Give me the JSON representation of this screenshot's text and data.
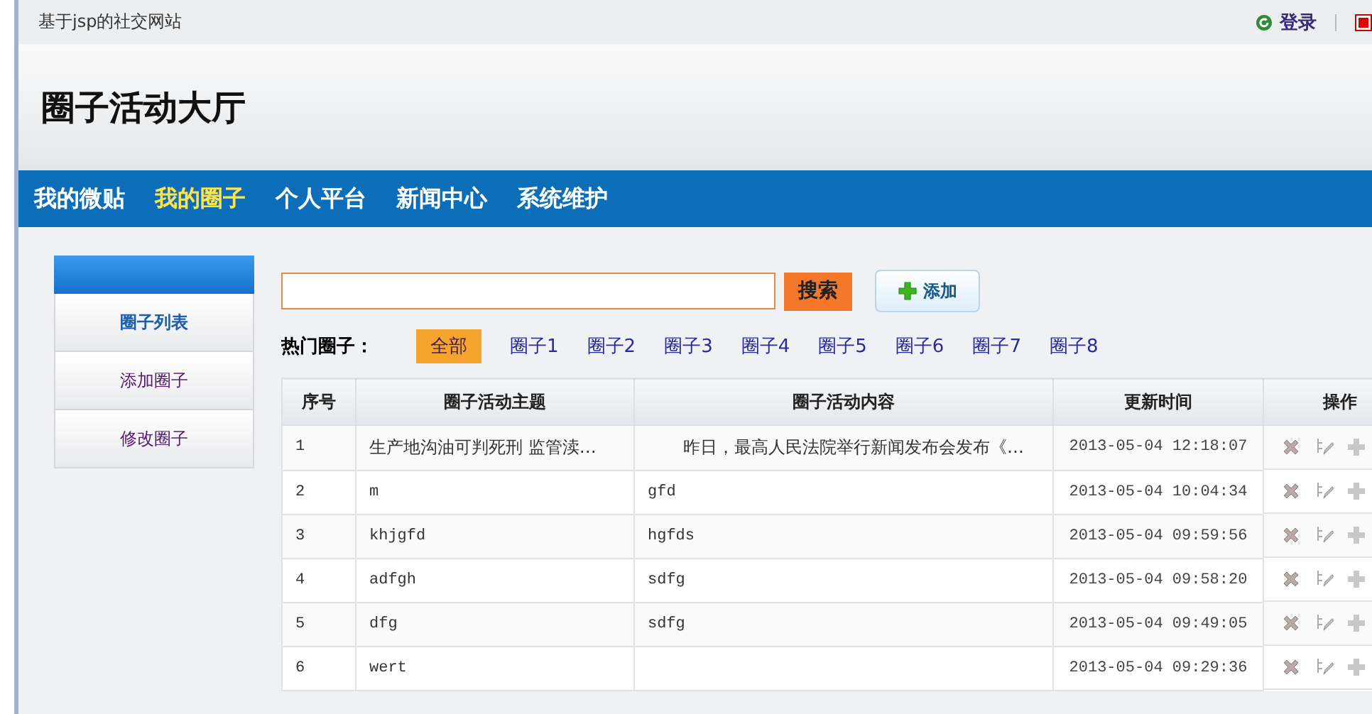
{
  "top_bar": {
    "site_title": "基于jsp的社交网站",
    "login_link": "登录"
  },
  "header": {
    "title": "圈子活动大厅"
  },
  "nav": [
    {
      "label": "我的微贴",
      "selected": false
    },
    {
      "label": "我的圈子",
      "selected": true
    },
    {
      "label": "个人平台",
      "selected": false
    },
    {
      "label": "新闻中心",
      "selected": false
    },
    {
      "label": "系统维护",
      "selected": false
    }
  ],
  "sidebar": {
    "items": [
      {
        "label": "圈子列表",
        "selected": true
      },
      {
        "label": "添加圈子",
        "selected": false
      },
      {
        "label": "修改圈子",
        "selected": false
      }
    ]
  },
  "search": {
    "button": "搜索",
    "add_button": "添加"
  },
  "hot": {
    "label": "热门圈子：",
    "tags": [
      {
        "label": "全部",
        "selected": true
      },
      {
        "label": "圈子1",
        "selected": false
      },
      {
        "label": "圈子2",
        "selected": false
      },
      {
        "label": "圈子3",
        "selected": false
      },
      {
        "label": "圈子4",
        "selected": false
      },
      {
        "label": "圈子5",
        "selected": false
      },
      {
        "label": "圈子6",
        "selected": false
      },
      {
        "label": "圈子7",
        "selected": false
      },
      {
        "label": "圈子8",
        "selected": false
      }
    ]
  },
  "table": {
    "columns": [
      "序号",
      "圈子活动主题",
      "圈子活动内容",
      "更新时间",
      "操作"
    ],
    "rows": [
      {
        "no": "1",
        "topic": "生产地沟油可判死刑 监管渎…",
        "content": "昨日，最高人民法院举行新闻发布会发布《…",
        "time": "2013-05-04 12:18:07"
      },
      {
        "no": "2",
        "topic": "m",
        "content": "gfd",
        "time": "2013-05-04 10:04:34"
      },
      {
        "no": "3",
        "topic": "khjgfd",
        "content": "hgfds",
        "time": "2013-05-04 09:59:56"
      },
      {
        "no": "4",
        "topic": "adfgh",
        "content": "sdfg",
        "time": "2013-05-04 09:58:20"
      },
      {
        "no": "5",
        "topic": "dfg",
        "content": "sdfg",
        "time": "2013-05-04 09:49:05"
      },
      {
        "no": "6",
        "topic": "wert",
        "time": "2013-05-04 09:29:36"
      }
    ]
  }
}
